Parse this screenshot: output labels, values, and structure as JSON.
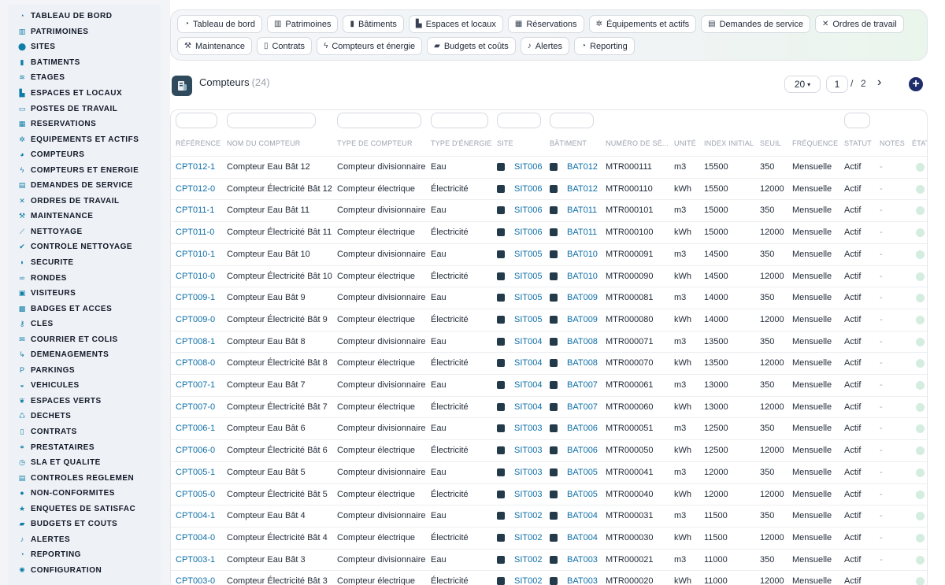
{
  "sidebar": {
    "items": [
      {
        "label": "TABLEAU DE BORD",
        "icon": "dashboard-icon",
        "glyph": "◔"
      },
      {
        "label": "PATRIMOINES",
        "icon": "building-icon",
        "glyph": "▥"
      },
      {
        "label": "SITES",
        "icon": "location-pin-icon",
        "glyph": "⬤"
      },
      {
        "label": "BÂTIMENTS",
        "icon": "building-icon",
        "glyph": "▮"
      },
      {
        "label": "ÉTAGES",
        "icon": "layers-icon",
        "glyph": "≋"
      },
      {
        "label": "ESPACES ET LOCAUX",
        "icon": "door-icon",
        "glyph": "▙"
      },
      {
        "label": "POSTES DE TRAVAIL",
        "icon": "monitor-icon",
        "glyph": "▭"
      },
      {
        "label": "RÉSERVATIONS",
        "icon": "calendar-icon",
        "glyph": "▦"
      },
      {
        "label": "ÉQUIPEMENTS ET ACTIFS",
        "icon": "gears-icon",
        "glyph": "✲"
      },
      {
        "label": "COMPTEURS",
        "icon": "gauge-icon",
        "glyph": "◕"
      },
      {
        "label": "COMPTEURS ET ÉNERGIE",
        "icon": "bolt-icon",
        "glyph": "ϟ"
      },
      {
        "label": "DEMANDES DE SERVICE",
        "icon": "clipboard-icon",
        "glyph": "▤"
      },
      {
        "label": "ORDRES DE TRAVAIL",
        "icon": "tools-icon",
        "glyph": "✕"
      },
      {
        "label": "MAINTENANCE",
        "icon": "wrench-icon",
        "glyph": "⚒"
      },
      {
        "label": "NETTOYAGE",
        "icon": "broom-icon",
        "glyph": "⟋"
      },
      {
        "label": "CONTRÔLE NETTOYAGE",
        "icon": "check-icon",
        "glyph": "✔"
      },
      {
        "label": "SÉCURITÉ",
        "icon": "shield-icon",
        "glyph": "◗"
      },
      {
        "label": "RONDES",
        "icon": "route-icon",
        "glyph": "∞"
      },
      {
        "label": "VISITEURS",
        "icon": "id-card-icon",
        "glyph": "▣"
      },
      {
        "label": "BADGES ET ACCÈS",
        "icon": "badge-icon",
        "glyph": "▩"
      },
      {
        "label": "CLÉS",
        "icon": "key-icon",
        "glyph": "⚷"
      },
      {
        "label": "COURRIER ET COLIS",
        "icon": "mail-icon",
        "glyph": "✉"
      },
      {
        "label": "DÉMÉNAGEMENTS",
        "icon": "dolly-icon",
        "glyph": "↳"
      },
      {
        "label": "PARKINGS",
        "icon": "parking-icon",
        "glyph": "P"
      },
      {
        "label": "VÉHICULES",
        "icon": "car-icon",
        "glyph": "◒"
      },
      {
        "label": "ESPACES VERTS",
        "icon": "leaf-icon",
        "glyph": "❦"
      },
      {
        "label": "DÉCHETS",
        "icon": "recycle-icon",
        "glyph": "♺"
      },
      {
        "label": "CONTRATS",
        "icon": "document-icon",
        "glyph": "▯"
      },
      {
        "label": "PRESTATAIRES",
        "icon": "handshake-icon",
        "glyph": "⚭"
      },
      {
        "label": "SLA ET QUALITÉ",
        "icon": "chart-icon",
        "glyph": "◷"
      },
      {
        "label": "CONTRÔLES RÉGLEMEN",
        "icon": "clipboard-check-icon",
        "glyph": "▤"
      },
      {
        "label": "NON-CONFORMITÉS",
        "icon": "alert-circle-icon",
        "glyph": "●"
      },
      {
        "label": "ENQUÊTES DE SATISFAC",
        "icon": "star-icon",
        "glyph": "★"
      },
      {
        "label": "BUDGETS ET COÛTS",
        "icon": "money-icon",
        "glyph": "▰"
      },
      {
        "label": "ALERTES",
        "icon": "bell-icon",
        "glyph": "♪"
      },
      {
        "label": "REPORTING",
        "icon": "pie-chart-icon",
        "glyph": "◔"
      },
      {
        "label": "CONFIGURATION",
        "icon": "gear-icon",
        "glyph": "✺"
      }
    ]
  },
  "topnav": {
    "row1": [
      {
        "label": "Tableau de bord",
        "icon": "dashboard-icon",
        "glyph": "◔"
      },
      {
        "label": "Patrimoines",
        "icon": "building-icon",
        "glyph": "▥"
      },
      {
        "label": "Bâtiments",
        "icon": "building-icon",
        "glyph": "▮"
      },
      {
        "label": "Espaces et locaux",
        "icon": "door-icon",
        "glyph": "▙"
      },
      {
        "label": "Réservations",
        "icon": "calendar-icon",
        "glyph": "▦"
      },
      {
        "label": "Équipements et actifs",
        "icon": "gears-icon",
        "glyph": "✲"
      },
      {
        "label": "Demandes de service",
        "icon": "clipboard-icon",
        "glyph": "▤"
      },
      {
        "label": "Ordres de travail",
        "icon": "tools-icon",
        "glyph": "✕"
      }
    ],
    "row2": [
      {
        "label": "Maintenance",
        "icon": "wrench-icon",
        "glyph": "⚒"
      },
      {
        "label": "Contrats",
        "icon": "document-icon",
        "glyph": "▯"
      },
      {
        "label": "Compteurs et énergie",
        "icon": "bolt-icon",
        "glyph": "ϟ"
      },
      {
        "label": "Budgets et coûts",
        "icon": "money-icon",
        "glyph": "▰"
      },
      {
        "label": "Alertes",
        "icon": "bell-icon",
        "glyph": "♪"
      },
      {
        "label": "Reporting",
        "icon": "pie-chart-icon",
        "glyph": "◔"
      }
    ]
  },
  "header": {
    "title": "Compteurs",
    "count": "(24)",
    "per_page": "20",
    "page_current": "1",
    "page_sep": "/",
    "page_total": "2",
    "next_glyph": "›",
    "add_glyph": "+"
  },
  "table": {
    "columns": [
      {
        "key": "ref",
        "label": "RÉFÉRENCE"
      },
      {
        "key": "name",
        "label": "NOM DU COMPTEUR"
      },
      {
        "key": "type",
        "label": "TYPE DE COMPTEUR"
      },
      {
        "key": "energy",
        "label": "TYPE D'ÉNERGIE"
      },
      {
        "key": "site",
        "label": "SITE"
      },
      {
        "key": "bat",
        "label": "BÂTIMENT"
      },
      {
        "key": "serial",
        "label": "NUMÉRO DE SÉ..."
      },
      {
        "key": "unit",
        "label": "UNITÉ"
      },
      {
        "key": "index",
        "label": "INDEX INITIAL"
      },
      {
        "key": "threshold",
        "label": "SEUIL"
      },
      {
        "key": "freq",
        "label": "FRÉQUENCE"
      },
      {
        "key": "status",
        "label": "STATUT"
      },
      {
        "key": "notes",
        "label": "NOTES"
      },
      {
        "key": "state",
        "label": "ÉTAT"
      }
    ],
    "rows": [
      {
        "ref": "CPT012-1",
        "name": "Compteur Eau Bât 12",
        "type": "Compteur divisionnaire",
        "energy": "Eau",
        "site": "SIT006",
        "bat": "BAT012",
        "serial": "MTR000111",
        "unit": "m3",
        "index": "15500",
        "threshold": "350",
        "freq": "Mensuelle",
        "status": "Actif",
        "notes": "-"
      },
      {
        "ref": "CPT012-0",
        "name": "Compteur Électricité Bât 12",
        "type": "Compteur électrique",
        "energy": "Électricité",
        "site": "SIT006",
        "bat": "BAT012",
        "serial": "MTR000110",
        "unit": "kWh",
        "index": "15500",
        "threshold": "12000",
        "freq": "Mensuelle",
        "status": "Actif",
        "notes": "-"
      },
      {
        "ref": "CPT011-1",
        "name": "Compteur Eau Bât 11",
        "type": "Compteur divisionnaire",
        "energy": "Eau",
        "site": "SIT006",
        "bat": "BAT011",
        "serial": "MTR000101",
        "unit": "m3",
        "index": "15000",
        "threshold": "350",
        "freq": "Mensuelle",
        "status": "Actif",
        "notes": "-"
      },
      {
        "ref": "CPT011-0",
        "name": "Compteur Électricité Bât 11",
        "type": "Compteur électrique",
        "energy": "Électricité",
        "site": "SIT006",
        "bat": "BAT011",
        "serial": "MTR000100",
        "unit": "kWh",
        "index": "15000",
        "threshold": "12000",
        "freq": "Mensuelle",
        "status": "Actif",
        "notes": "-"
      },
      {
        "ref": "CPT010-1",
        "name": "Compteur Eau Bât 10",
        "type": "Compteur divisionnaire",
        "energy": "Eau",
        "site": "SIT005",
        "bat": "BAT010",
        "serial": "MTR000091",
        "unit": "m3",
        "index": "14500",
        "threshold": "350",
        "freq": "Mensuelle",
        "status": "Actif",
        "notes": "-"
      },
      {
        "ref": "CPT010-0",
        "name": "Compteur Électricité Bât 10",
        "type": "Compteur électrique",
        "energy": "Électricité",
        "site": "SIT005",
        "bat": "BAT010",
        "serial": "MTR000090",
        "unit": "kWh",
        "index": "14500",
        "threshold": "12000",
        "freq": "Mensuelle",
        "status": "Actif",
        "notes": "-"
      },
      {
        "ref": "CPT009-1",
        "name": "Compteur Eau Bât 9",
        "type": "Compteur divisionnaire",
        "energy": "Eau",
        "site": "SIT005",
        "bat": "BAT009",
        "serial": "MTR000081",
        "unit": "m3",
        "index": "14000",
        "threshold": "350",
        "freq": "Mensuelle",
        "status": "Actif",
        "notes": "-"
      },
      {
        "ref": "CPT009-0",
        "name": "Compteur Électricité Bât 9",
        "type": "Compteur électrique",
        "energy": "Électricité",
        "site": "SIT005",
        "bat": "BAT009",
        "serial": "MTR000080",
        "unit": "kWh",
        "index": "14000",
        "threshold": "12000",
        "freq": "Mensuelle",
        "status": "Actif",
        "notes": "-"
      },
      {
        "ref": "CPT008-1",
        "name": "Compteur Eau Bât 8",
        "type": "Compteur divisionnaire",
        "energy": "Eau",
        "site": "SIT004",
        "bat": "BAT008",
        "serial": "MTR000071",
        "unit": "m3",
        "index": "13500",
        "threshold": "350",
        "freq": "Mensuelle",
        "status": "Actif",
        "notes": "-"
      },
      {
        "ref": "CPT008-0",
        "name": "Compteur Électricité Bât 8",
        "type": "Compteur électrique",
        "energy": "Électricité",
        "site": "SIT004",
        "bat": "BAT008",
        "serial": "MTR000070",
        "unit": "kWh",
        "index": "13500",
        "threshold": "12000",
        "freq": "Mensuelle",
        "status": "Actif",
        "notes": "-"
      },
      {
        "ref": "CPT007-1",
        "name": "Compteur Eau Bât 7",
        "type": "Compteur divisionnaire",
        "energy": "Eau",
        "site": "SIT004",
        "bat": "BAT007",
        "serial": "MTR000061",
        "unit": "m3",
        "index": "13000",
        "threshold": "350",
        "freq": "Mensuelle",
        "status": "Actif",
        "notes": "-"
      },
      {
        "ref": "CPT007-0",
        "name": "Compteur Électricité Bât 7",
        "type": "Compteur électrique",
        "energy": "Électricité",
        "site": "SIT004",
        "bat": "BAT007",
        "serial": "MTR000060",
        "unit": "kWh",
        "index": "13000",
        "threshold": "12000",
        "freq": "Mensuelle",
        "status": "Actif",
        "notes": "-"
      },
      {
        "ref": "CPT006-1",
        "name": "Compteur Eau Bât 6",
        "type": "Compteur divisionnaire",
        "energy": "Eau",
        "site": "SIT003",
        "bat": "BAT006",
        "serial": "MTR000051",
        "unit": "m3",
        "index": "12500",
        "threshold": "350",
        "freq": "Mensuelle",
        "status": "Actif",
        "notes": "-"
      },
      {
        "ref": "CPT006-0",
        "name": "Compteur Électricité Bât 6",
        "type": "Compteur électrique",
        "energy": "Électricité",
        "site": "SIT003",
        "bat": "BAT006",
        "serial": "MTR000050",
        "unit": "kWh",
        "index": "12500",
        "threshold": "12000",
        "freq": "Mensuelle",
        "status": "Actif",
        "notes": "-"
      },
      {
        "ref": "CPT005-1",
        "name": "Compteur Eau Bât 5",
        "type": "Compteur divisionnaire",
        "energy": "Eau",
        "site": "SIT003",
        "bat": "BAT005",
        "serial": "MTR000041",
        "unit": "m3",
        "index": "12000",
        "threshold": "350",
        "freq": "Mensuelle",
        "status": "Actif",
        "notes": "-"
      },
      {
        "ref": "CPT005-0",
        "name": "Compteur Électricité Bât 5",
        "type": "Compteur électrique",
        "energy": "Électricité",
        "site": "SIT003",
        "bat": "BAT005",
        "serial": "MTR000040",
        "unit": "kWh",
        "index": "12000",
        "threshold": "12000",
        "freq": "Mensuelle",
        "status": "Actif",
        "notes": "-"
      },
      {
        "ref": "CPT004-1",
        "name": "Compteur Eau Bât 4",
        "type": "Compteur divisionnaire",
        "energy": "Eau",
        "site": "SIT002",
        "bat": "BAT004",
        "serial": "MTR000031",
        "unit": "m3",
        "index": "11500",
        "threshold": "350",
        "freq": "Mensuelle",
        "status": "Actif",
        "notes": "-"
      },
      {
        "ref": "CPT004-0",
        "name": "Compteur Électricité Bât 4",
        "type": "Compteur électrique",
        "energy": "Électricité",
        "site": "SIT002",
        "bat": "BAT004",
        "serial": "MTR000030",
        "unit": "kWh",
        "index": "11500",
        "threshold": "12000",
        "freq": "Mensuelle",
        "status": "Actif",
        "notes": "-"
      },
      {
        "ref": "CPT003-1",
        "name": "Compteur Eau Bât 3",
        "type": "Compteur divisionnaire",
        "energy": "Eau",
        "site": "SIT002",
        "bat": "BAT003",
        "serial": "MTR000021",
        "unit": "m3",
        "index": "11000",
        "threshold": "350",
        "freq": "Mensuelle",
        "status": "Actif",
        "notes": "-"
      },
      {
        "ref": "CPT003-0",
        "name": "Compteur Électricité Bât 3",
        "type": "Compteur électrique",
        "energy": "Électricité",
        "site": "SIT002",
        "bat": "BAT003",
        "serial": "MTR000020",
        "unit": "kWh",
        "index": "11000",
        "threshold": "12000",
        "freq": "Mensuelle",
        "status": "Actif",
        "notes": ""
      }
    ]
  },
  "colors": {
    "accent": "#0e6fa8",
    "sidebar_icon": "#0e7ea8",
    "add_button": "#1e2d6b",
    "status_dot": "#d4ede0"
  }
}
